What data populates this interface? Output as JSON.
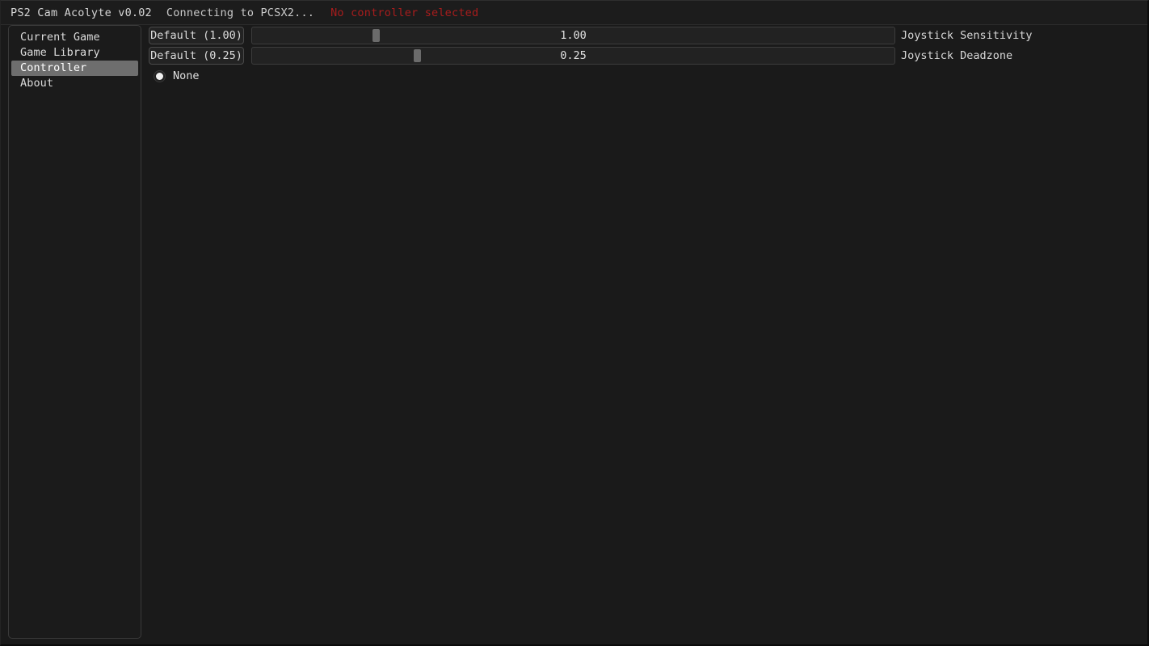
{
  "window": {
    "background": "#1a1a1a"
  },
  "title_bar": {
    "app_title": "PS2 Cam Acolyte v0.02",
    "connection_status": "Connecting to PCSX2...",
    "warning": "No controller selected",
    "warning_color": "#a81c1c"
  },
  "sidebar": {
    "items": [
      {
        "label": "Current Game",
        "selected": false
      },
      {
        "label": "Game Library",
        "selected": false
      },
      {
        "label": "Controller",
        "selected": true
      },
      {
        "label": "About",
        "selected": false
      }
    ]
  },
  "main": {
    "settings": [
      {
        "default_label": "Default (1.00)",
        "value_text": "1.00",
        "value": 1.0,
        "min": 0.0,
        "max": 5.0,
        "handle_pct": 18.8,
        "name": "Joystick Sensitivity"
      },
      {
        "default_label": "Default (0.25)",
        "value_text": "0.25",
        "value": 0.25,
        "min": 0.0,
        "max": 1.0,
        "handle_pct": 25.2,
        "name": "Joystick Deadzone"
      }
    ],
    "controller_option": {
      "label": "None",
      "selected": true
    }
  }
}
